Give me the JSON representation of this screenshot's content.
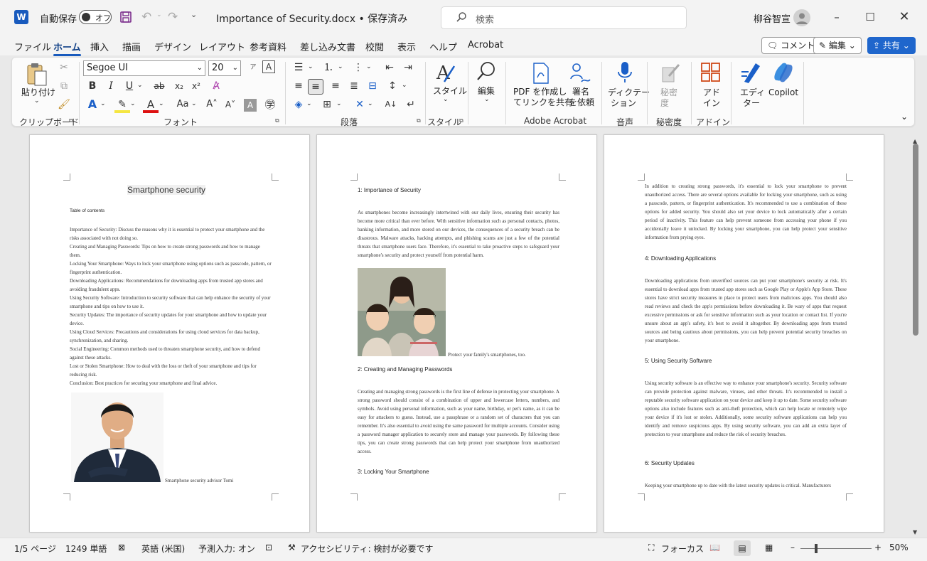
{
  "titlebar": {
    "app_icon": "W",
    "autosave_label": "自動保存",
    "autosave_state": "オフ",
    "doc_title": "Importance of Security.docx • 保存済み",
    "search_placeholder": "検索",
    "user_name": "柳谷智宣"
  },
  "menu": [
    "ファイル",
    "ホーム",
    "挿入",
    "描画",
    "デザイン",
    "レイアウト",
    "参考資料",
    "差し込み文書",
    "校閲",
    "表示",
    "ヘルプ",
    "Acrobat"
  ],
  "menu_active": "ホーム",
  "top_buttons": {
    "comment": "コメント",
    "edit": "編集",
    "share": "共有"
  },
  "ribbon": {
    "paste": "貼り付け",
    "font_name": "Segoe UI",
    "font_size": "20",
    "groups": {
      "clipboard": "クリップボード",
      "font": "フォント",
      "paragraph": "段落",
      "styles": "スタイル",
      "acrobat": "Adobe Acrobat",
      "voice": "音声",
      "sensitivity": "秘密度",
      "addins": "アドイン"
    },
    "big_buttons": {
      "style": "スタイル",
      "edit": "編集",
      "pdf1": "PDF を作成し",
      "pdf2": "てリンクを共有",
      "sign1": "署名",
      "sign2": "を依頼",
      "dict1": "ディクテー",
      "dict2": "ション",
      "secret1": "秘密",
      "secret2": "度",
      "addin1": "アド",
      "addin2": "イン",
      "editor1": "エディ",
      "editor2": "ター",
      "copilot": "Copilot"
    }
  },
  "page1": {
    "title": "Smartphone security",
    "toc_heading": "Table of contents",
    "toc": [
      "Importance of Security: Discuss the reasons why it is essential to protect your smartphone and the risks associated with not doing so.",
      "Creating and Managing Passwords: Tips on how to create strong passwords and how to manage them.",
      "Locking Your Smartphone: Ways to lock your smartphone using options such as passcode, pattern, or fingerprint authentication.",
      "Downloading Applications: Recommendations for downloading apps from trusted app stores and avoiding fraudulent apps.",
      "Using Security Software: Introduction to security software that can help enhance the security of your smartphone and tips on how to use it.",
      "Security Updates: The importance of security updates for your smartphone and how to update your device.",
      "Using Cloud Services: Precautions and considerations for using cloud services for data backup, synchronization, and sharing.",
      "Social Engineering: Common methods used to threaten smartphone security, and how to defend against these attacks.",
      "Lost or Stolen Smartphone: How to deal with the loss or theft of your smartphone and tips for reducing risk.",
      "Conclusion: Best practices for securing your smartphone and final advice."
    ],
    "caption": "Smartphone security advisor Tomi"
  },
  "page2": {
    "h1": "1: Importance of Security",
    "p1": "As smartphones become increasingly intertwined with our daily lives, ensuring their security has become more critical than ever before. With sensitive information such as personal contacts, photos, banking information, and more stored on our devices, the consequences of a security breach can be disastrous. Malware attacks, hacking attempts, and phishing scams are just a few of the potential threats that smartphone users face. Therefore, it's essential to take proactive steps to safeguard your smartphone's security and protect yourself from potential harm.",
    "caption": "Protect your family's smartphones, too.",
    "h2": "2: Creating and Managing Passwords",
    "p2": "Creating and managing strong passwords is the first line of defense in protecting your smartphone. A strong password should consist of a combination of upper and lowercase letters, numbers, and symbols. Avoid using personal information, such as your name, birthday, or pet's name, as it can be easy for attackers to guess. Instead, use a passphrase or a random set of characters that you can remember. It's also essential to avoid using the same password for multiple accounts. Consider using a password manager application to securely store and manage your passwords. By following these tips, you can create strong passwords that can help protect your smartphone from unauthorized access.",
    "h3": "3: Locking Your Smartphone"
  },
  "page3": {
    "p0": "In addition to creating strong passwords, it's essential to lock your smartphone to prevent unauthorized access. There are several options available for locking your smartphone, such as using a passcode, pattern, or fingerprint authentication. It's recommended to use a combination of these options for added security. You should also set your device to lock automatically after a certain period of inactivity. This feature can help prevent someone from accessing your phone if you accidentally leave it unlocked. By locking your smartphone, you can help protect your sensitive information from prying eyes.",
    "h4": "4: Downloading Applications",
    "p4": "Downloading applications from unverified sources can put your smartphone's security at risk. It's essential to download apps from trusted app stores such as Google Play or Apple's App Store. These stores have strict security measures in place to protect users from malicious apps. You should also read reviews and check the app's permissions before downloading it. Be wary of apps that request excessive permissions or ask for sensitive information such as your location or contact list. If you're unsure about an app's safety, it's best to avoid it altogether. By downloading apps from trusted sources and being cautious about permissions, you can help prevent potential security breaches on your smartphone.",
    "h5": "5: Using Security Software",
    "p5": "Using security software is an effective way to enhance your smartphone's security. Security software can provide protection against malware, viruses, and other threats. It's recommended to install a reputable security software application on your device and keep it up to date. Some security software options also include features such as anti-theft protection, which can help locate or remotely wipe your device if it's lost or stolen. Additionally, some security software applications can help you identify and remove suspicious apps. By using security software, you can add an extra layer of protection to your smartphone and reduce the risk of security breaches.",
    "h6": "6: Security Updates",
    "p6": "Keeping your smartphone up to date with the latest security updates is critical. Manufacturers"
  },
  "statusbar": {
    "page": "1/5 ページ",
    "words": "1249 単語",
    "language": "英語 (米国)",
    "predict": "予測入力: オン",
    "accessibility": "アクセシビリティ: 検討が必要です",
    "focus": "フォーカス",
    "zoom": "50%"
  },
  "colors": {
    "accent": "#185abd",
    "share": "#1f66cc"
  }
}
